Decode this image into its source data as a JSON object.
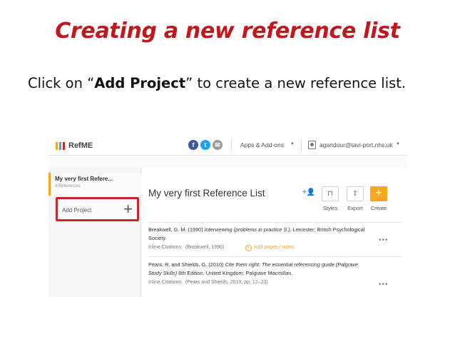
{
  "slide": {
    "title": "Creating a new reference list",
    "instruction_prefix": "Click on “",
    "instruction_bold": "Add Project",
    "instruction_suffix": "” to create a new reference list."
  },
  "app": {
    "brand": "RefME",
    "brand_colors": [
      "#f5a623",
      "#4aa3df",
      "#c8262c"
    ],
    "social_icons": [
      {
        "icon": "facebook-icon",
        "glyph": "f",
        "color": "#3b5998"
      },
      {
        "icon": "twitter-icon",
        "glyph": "t",
        "color": "#1da1f2"
      },
      {
        "icon": "email-icon",
        "glyph": "✉",
        "color": "#9a9a9a"
      }
    ],
    "apps_menu": "Apps & Add-ons",
    "user_email": "agandour@tavi-port.nhs.uk"
  },
  "sidebar": {
    "active_project": {
      "title": "My very first Refere...",
      "subtitle": "4 References"
    },
    "add_project_label": "Add Project",
    "add_project_icon": "+",
    "highlight_color": "#c8262c"
  },
  "main": {
    "list_title": "My very first Reference List",
    "toolbar": [
      {
        "label": "Styles",
        "icon": "book-icon",
        "glyph": "⊓"
      },
      {
        "label": "Export",
        "icon": "export-icon",
        "glyph": "⇪"
      },
      {
        "label": "Create",
        "icon": "plus-icon",
        "glyph": "+"
      }
    ],
    "references": [
      {
        "citation_plain_1": "Breakwell, G. M. (1990) ",
        "citation_italic": "Interviewing (problems in practice S.).",
        "citation_plain_2": " Leicester: British Psychological Society.",
        "inline_label": "Inline Citations:",
        "inline_value": "(Breakwell, 1990)",
        "add_pages": "Add pages / notes"
      },
      {
        "citation_plain_1": "Pears, R. and Shields, G. (2010) ",
        "citation_italic": "Cite them right: The essential referencing guide (Palgrave Study Skills)",
        "citation_plain_2": " 8th Edition. United Kingdom: Palgrave Macmillan.",
        "inline_label": "Inline Citations:",
        "inline_value": "(Pears and Shields, 2010, pp. 12–23)"
      }
    ],
    "more_glyph": "•••"
  }
}
